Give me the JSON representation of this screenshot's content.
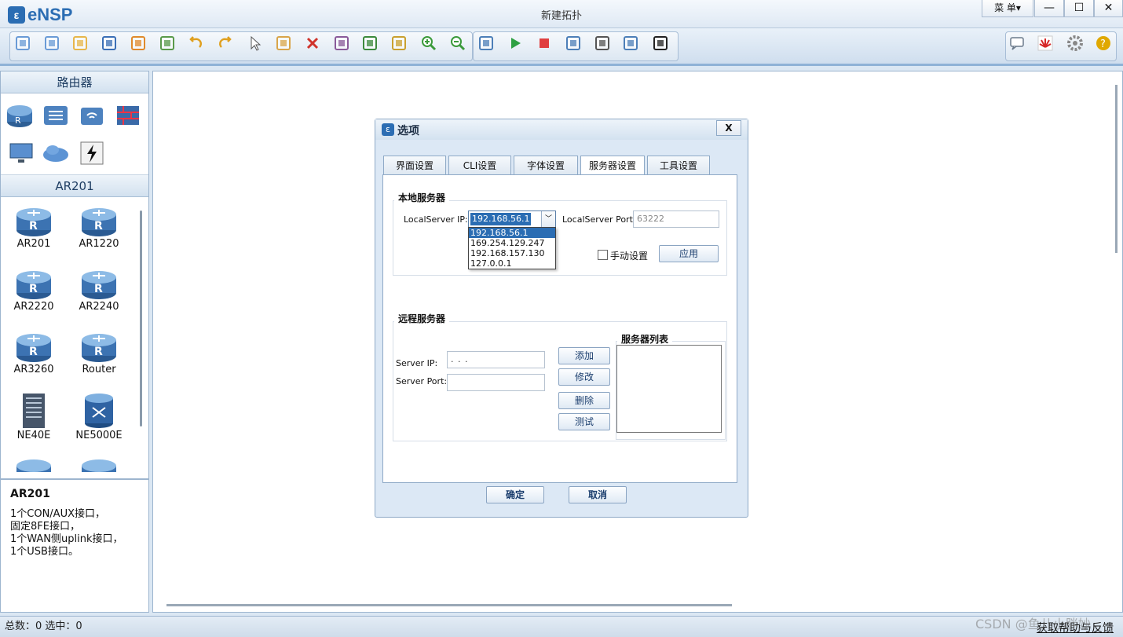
{
  "app": {
    "logo_text": "eNSP",
    "window_title": "新建拓扑",
    "menu_label": "菜 单▾",
    "win_minimize": "—",
    "win_maximize": "☐",
    "win_close": "✕"
  },
  "toolbar": {
    "left_icons": [
      "new-topology-icon",
      "new-lab-icon",
      "open-icon",
      "save-icon",
      "save-as-icon",
      "print-icon",
      "undo-icon",
      "redo-icon",
      "select-icon",
      "hand-icon",
      "delete-icon",
      "delete-link-icon",
      "text-icon",
      "rectangle-icon",
      "zoom-in-icon",
      "zoom-out-icon",
      "fit-icon",
      "start-icon",
      "stop-icon",
      "capture-icon",
      "topology-icon",
      "grid-icon",
      "screenshot-icon"
    ],
    "right_icons": [
      "chat-icon",
      "huawei-icon",
      "settings-icon",
      "help-icon"
    ]
  },
  "left_panel": {
    "category_header": "路由器",
    "category_icons": [
      "router-category-icon",
      "switch-category-icon",
      "wireless-category-icon",
      "firewall-category-icon",
      "pc-category-icon",
      "cloud-category-icon",
      "link-category-icon"
    ],
    "device_header": "AR201",
    "devices": [
      "AR201",
      "AR1220",
      "AR2220",
      "AR2240",
      "AR3260",
      "Router",
      "NE40E",
      "NE5000E"
    ],
    "description_title": "AR201",
    "description_lines": [
      "1个CON/AUX接口，",
      "固定8FE接口，",
      "1个WAN侧uplink接口，",
      "1个USB接口。"
    ]
  },
  "statusbar": {
    "text": "总数：0  选中：0",
    "feedback": "获取帮助与反馈",
    "watermark": "CSDN @鱼儿小胖妙"
  },
  "dialog": {
    "title": "选项",
    "close": "X",
    "tabs": [
      "界面设置",
      "CLI设置",
      "字体设置",
      "服务器设置",
      "工具设置"
    ],
    "active_tab": 3,
    "local": {
      "group_title": "本地服务器",
      "ip_label": "LocalServer IP:",
      "ip_value": "192.168.56.1",
      "ip_options": [
        "192.168.56.1",
        "169.254.129.247",
        "192.168.157.130",
        "127.0.0.1"
      ],
      "port_label": "LocalServer Port:",
      "port_value": "63222",
      "manual_label": "手动设置",
      "apply_button": "应用"
    },
    "remote": {
      "group_title": "远程服务器",
      "ip_label": "Server IP:",
      "ip_placeholder": ".      .      .",
      "port_label": "Server Port:",
      "port_value": "",
      "buttons": {
        "add": "添加",
        "modify": "修改",
        "delete": "删除",
        "test": "测试"
      },
      "list_title": "服务器列表"
    },
    "ok_button": "确定",
    "cancel_button": "取消"
  }
}
